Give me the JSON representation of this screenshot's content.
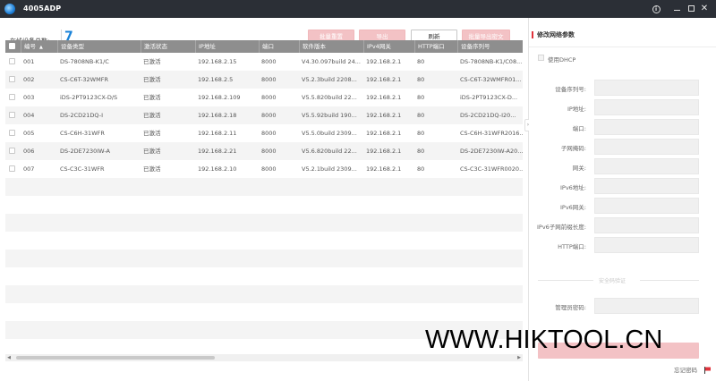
{
  "app": {
    "title": "4005ADP"
  },
  "summary": {
    "online_label": "在线设备总数:",
    "online_count": "7"
  },
  "toolbar": {
    "batch_reset": "批量重置",
    "export": "导出",
    "refresh": "刷新",
    "batch_export_qr": "批量导出密文"
  },
  "table": {
    "columns": [
      "编号",
      "设备类型",
      "激活状态",
      "IP地址",
      "端口",
      "软件版本",
      "IPv4网关",
      "HTTP端口",
      "设备序列号"
    ],
    "rows": [
      [
        "001",
        "DS-7808NB-K1/C",
        "已激活",
        "192.168.2.15",
        "8000",
        "V4.30.097build 24...",
        "192.168.2.1",
        "80",
        "DS-7808NB-K1/C08..."
      ],
      [
        "002",
        "CS-C6T-32WMFR",
        "已激活",
        "192.168.2.5",
        "8000",
        "V5.2.3build 2208...",
        "192.168.2.1",
        "80",
        "CS-C6T-32WMFR01..."
      ],
      [
        "003",
        "iDS-2PT9123CX-D/S",
        "已激活",
        "192.168.2.109",
        "8000",
        "V5.5.820build 22...",
        "192.168.2.1",
        "80",
        "iDS-2PT9123CX-D..."
      ],
      [
        "004",
        "DS-2CD21DQ-I",
        "已激活",
        "192.168.2.18",
        "8000",
        "V5.5.92build 190...",
        "192.168.2.1",
        "80",
        "DS-2CD21DQ-I20..."
      ],
      [
        "005",
        "CS-C6H-31WFR",
        "已激活",
        "192.168.2.11",
        "8000",
        "V5.5.0build 2309...",
        "192.168.2.1",
        "80",
        "CS-C6H-31WFR2016..."
      ],
      [
        "006",
        "DS-2DE7230IW-A",
        "已激活",
        "192.168.2.21",
        "8000",
        "V5.6.820build 22...",
        "192.168.2.1",
        "80",
        "DS-2DE7230IW-A20..."
      ],
      [
        "007",
        "CS-C3C-31WFR",
        "已激活",
        "192.168.2.10",
        "8000",
        "V5.2.1build 2309...",
        "192.168.2.1",
        "80",
        "CS-C3C-31WFR0020..."
      ]
    ]
  },
  "panel": {
    "title": "修改网络参数",
    "dhcp_label": "使用DHCP",
    "fields": [
      "设备序列号:",
      "IP地址:",
      "端口:",
      "子网掩码:",
      "网关:",
      "IPv6地址:",
      "IPv6网关:",
      "IPv6子网前缀长度:",
      "HTTP端口:"
    ],
    "security_label": "安全码验证",
    "password_label": "管理员密码:",
    "forgot_password": "忘记密码"
  },
  "watermark": "WWW.HIKTOOL.CN",
  "colors": {
    "accent": "#e0333c",
    "count_blue": "#1a83d8",
    "disabled_btn": "#f3c2c5",
    "header_gray": "#8e8e8e"
  }
}
